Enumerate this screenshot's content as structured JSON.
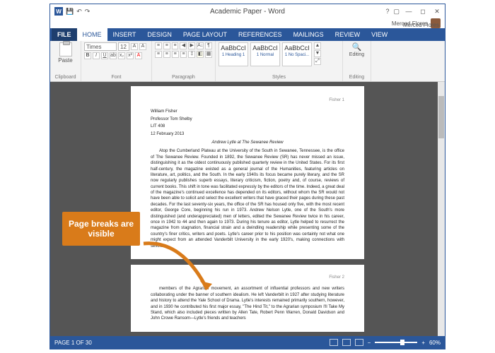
{
  "title": "Academic Paper - Word",
  "user": "Merced Flores",
  "tabs": [
    "FILE",
    "HOME",
    "INSERT",
    "DESIGN",
    "PAGE LAYOUT",
    "REFERENCES",
    "MAILINGS",
    "REVIEW",
    "VIEW"
  ],
  "ribbon": {
    "clipboard": {
      "paste": "Paste",
      "label": "Clipboard"
    },
    "font": {
      "name": "Times",
      "size": "12",
      "label": "Font"
    },
    "paragraph": {
      "label": "Paragraph"
    },
    "styles": {
      "label": "Styles",
      "items": [
        {
          "sample": "AaBbCcI",
          "name": "1 Heading 1"
        },
        {
          "sample": "AaBbCcI",
          "name": "1 Normal"
        },
        {
          "sample": "AaBbCcI",
          "name": "1 No Spaci..."
        }
      ]
    },
    "editing": {
      "label": "Editing"
    }
  },
  "document": {
    "page1_header": "Fisher 1",
    "page2_header": "Fisher 2",
    "lines": [
      "William Fisher",
      "Professor Tom Shelby",
      "LIT 408",
      "12 February 2013"
    ],
    "title_text": "Andrew Lytle at The Sewanee Review",
    "body1": "Atop the Cumberland Plateau at the University of the South in Sewanee, Tennessee, is the office of The Sewanee Review. Founded in 1892, the Sewanee Review (SR) has never missed an issue, distinguishing it as the oldest continuously published quarterly review in the United States. For its first half-century, the magazine existed as a general journal of the Humanities, featuring articles on literature, art, politics, and the South. In the early 1940s its focus became purely literary, and the SR now regularly publishes superb essays, literary criticism, fiction, poetry and, of course, reviews of current books. This shift in tone was facilitated expressly by the editors of the time. Indeed, a great deal of the magazine's continued excellence has depended on its editors, without whom the SR would not have been able to solicit and select the excellent writers that have graced their pages during these past decades. For the last seventy-six years, the office of the SR has housed only five, with the most recent editor, George Core, beginning his run in 1973. Andrew Nelson Lytle, one of the South's more distinguished (and underappreciated) men of letters, edited the Sewanee Review twice in his career, once in 1942 to 44 and then again to 1973. During his tenure as editor, Lytle helped to resurrect the magazine from stagnation, financial strain and a dwindling readership while presenting some of the country's finer critics, writers and poets. Lytle's career prior to his position was certainly not what one might expect from an attended Vanderbilt University in the early 1920's, making connections with several",
    "body2": "members of the Agrarian movement, an assortment of influential professors and new writers collaborating under the banner of southern idealism. He left Vanderbilt in 1927 after studying literature and history to attend the Yale School of Drama. Lytle's interests remained primarily southern, however, and in 1930 he contributed his first major essay, \"The Hind Tit,\" to the Agrarian symposium I'll Take My Stand, which also included pieces written by Allen Tate, Robert Penn Warren, Donald Davidson and John Crowe Ransom—Lytle's friends and teachers"
  },
  "callout": "Page breaks are visible",
  "statusbar": {
    "page": "PAGE 1 OF 30",
    "zoom": "60%"
  }
}
